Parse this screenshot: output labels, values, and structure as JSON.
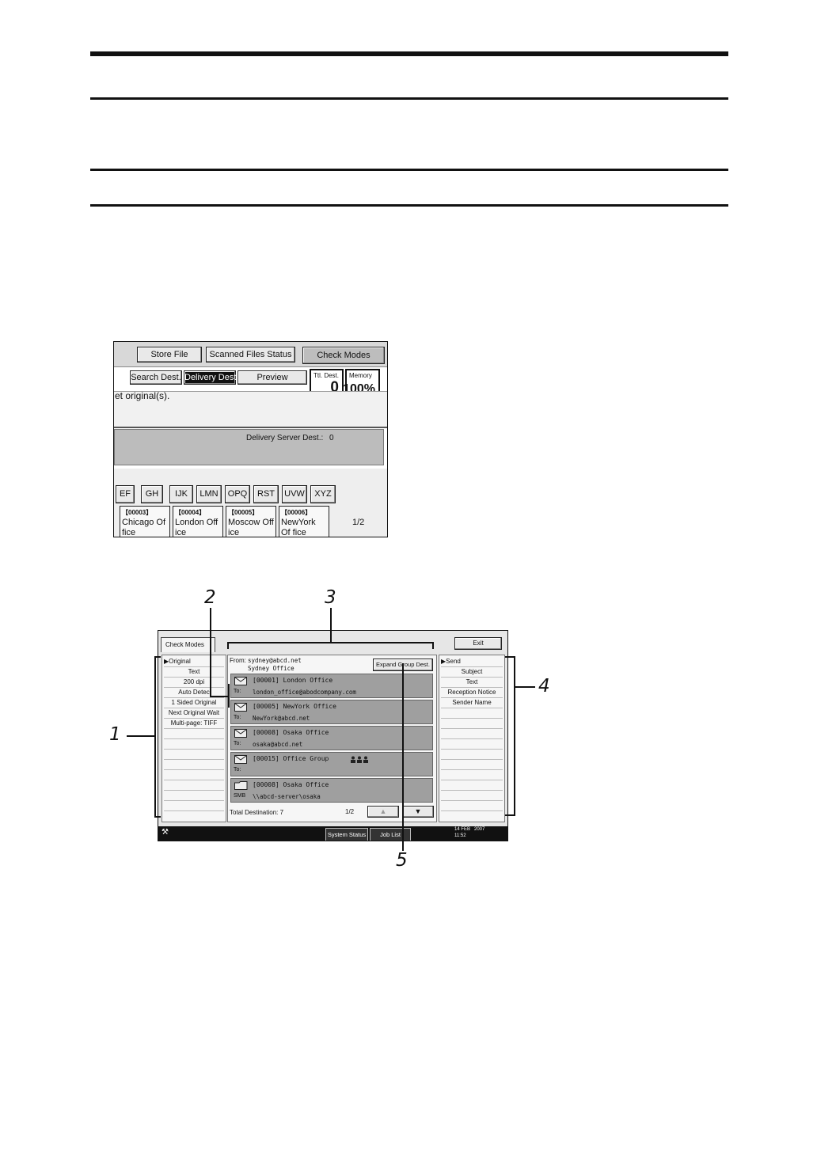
{
  "shot1": {
    "buttons": {
      "store_file": "Store File",
      "scanned_files_status": "Scanned Files Status",
      "check_modes": "Check Modes"
    },
    "tabs": {
      "search_dest": "Search Dest.",
      "delivery_dest": "Delivery Dest.",
      "preview": "Preview"
    },
    "counters": {
      "ttl_label": "Ttl. Dest.",
      "ttl_value": "0",
      "memory_label": "Memory",
      "memory_value": "100%"
    },
    "message": "et original(s).",
    "delivery_server_label": "Delivery Server Dest.:",
    "delivery_server_value": "0",
    "alpha_tabs": [
      "EF",
      "GH",
      "IJK",
      "LMN",
      "OPQ",
      "RST",
      "UVW",
      "XYZ"
    ],
    "destinations": [
      {
        "code": "【00003】",
        "name": "Chicago Of fice"
      },
      {
        "code": "【00004】",
        "name": "London Off ice"
      },
      {
        "code": "【00005】",
        "name": "Moscow Off ice"
      },
      {
        "code": "【00006】",
        "name": "NewYork Of fice"
      }
    ],
    "page": "1/2"
  },
  "shot2": {
    "title": "Check Modes",
    "exit_label": "Exit",
    "left_items": [
      "▶Original",
      "Text",
      "200 dpi",
      "Auto Detec",
      "1 Sided Original",
      "Next Original Wait",
      "Multi-page: TIFF"
    ],
    "from_label": "From:",
    "from_email": "sydney@abcd.net",
    "from_name": "Sydney Office",
    "expand_group": "Expand Group Dest.",
    "entries": [
      {
        "name": "[00001] London Office",
        "label": "To:",
        "addr": "london_office@abodcompany.com",
        "icon": "email-icon"
      },
      {
        "name": "[00005] NewYork Office",
        "label": "To:",
        "addr": "NewYork@abcd.net",
        "icon": "email-icon"
      },
      {
        "name": "[00008] Osaka Office",
        "label": "To:",
        "addr": "osaka@abcd.net",
        "icon": "email-icon"
      },
      {
        "name": "[00015] Office Group",
        "label": "To:",
        "addr": "",
        "icon": "email-icon"
      },
      {
        "name": "[00008] Osaka Office",
        "label": "SMB",
        "addr": "\\\\abcd-server\\osaka",
        "icon": "folder-icon"
      }
    ],
    "total_label": "Total Destination: 7",
    "page": "1/2",
    "up_arrow": "▲",
    "down_arrow": "▼",
    "right_items": [
      "▶Send",
      "Subject",
      "Text",
      "Reception Notice",
      "Sender Name"
    ],
    "status_bar": {
      "system_status": "System Status",
      "job_list": "Job List",
      "date": "14 FEB   2007",
      "time": "11:52"
    }
  },
  "callouts": [
    "1",
    "2",
    "3",
    "4",
    "5"
  ]
}
